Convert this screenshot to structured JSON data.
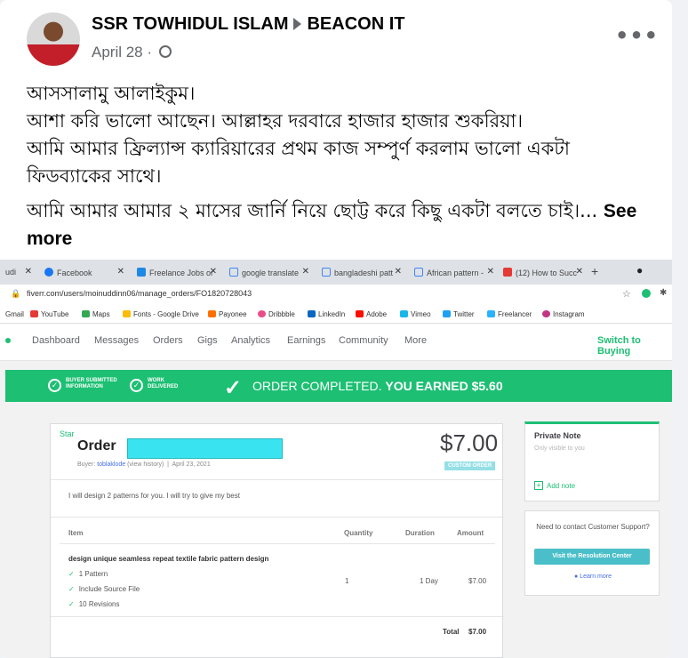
{
  "post": {
    "author": "SSR TOWHIDUL ISLAM",
    "group": "BEACON IT",
    "date": "April 28 ·",
    "more_icon": "more-options-icon",
    "line1": "আসসালামু আলাইকুম।",
    "line2": "আশা করি ভালো আছেন। আল্লাহর দরবারে হাজার হাজার শুকরিয়া।",
    "line3": "আমি আমার ফ্রিল্যান্স ক্যারিয়ারের প্রথম কাজ সম্পুর্ণ করলাম ভালো একটা ফিডব্যাকের সাথে।",
    "line4": "আমি আমার আমার ২ মাসের জার্নি নিয়ে ছোট্ট করে কিছু একটা বলতে চাই।...",
    "see_more": "See more"
  },
  "browser": {
    "tabs": [
      {
        "label": "udi",
        "color": "#1dbf73"
      },
      {
        "label": "Facebook",
        "color": "#1877f2"
      },
      {
        "label": "Freelance Jobs or",
        "color": "#1e88e5"
      },
      {
        "label": "google translate",
        "color": "#4285f4"
      },
      {
        "label": "bangladeshi patt",
        "color": "#4285f4"
      },
      {
        "label": "African pattern -",
        "color": "#4285f4"
      },
      {
        "label": "(12) How to Succ",
        "color": "#e53935"
      }
    ],
    "url": "fiverr.com/users/moinuddinn06/manage_orders/FO1820728043",
    "bookmarks": [
      {
        "label": "Gmail",
        "color": "#ea4335"
      },
      {
        "label": "YouTube",
        "color": "#e53935"
      },
      {
        "label": "Maps",
        "color": "#34a853"
      },
      {
        "label": "Fonts - Google Drive",
        "color": "#fbbc05"
      },
      {
        "label": "Payonee",
        "color": "#ff6f00"
      },
      {
        "label": "Dribbble",
        "color": "#ea4c89"
      },
      {
        "label": "LinkedIn",
        "color": "#0a66c2"
      },
      {
        "label": "Adobe",
        "color": "#fa0f00"
      },
      {
        "label": "Vimeo",
        "color": "#1ab7ea"
      },
      {
        "label": "Twitter",
        "color": "#1da1f2"
      },
      {
        "label": "Freelancer",
        "color": "#29b2fe"
      },
      {
        "label": "Instagram",
        "color": "#c13584"
      }
    ]
  },
  "fiverr": {
    "nav": [
      "Dashboard",
      "Messages",
      "Orders",
      "Gigs",
      "Analytics",
      "Earnings",
      "Community",
      "More"
    ],
    "switch": "Switch to Buying",
    "step1": [
      "BUYER SUBMITTED",
      "INFORMATION"
    ],
    "step2": [
      "WORK",
      "DELIVERED"
    ],
    "banner_text": "ORDER COMPLETED.",
    "banner_bold": "YOU EARNED $5.60",
    "star": "Star",
    "order_title": "Order",
    "buyer_label": "Buyer:",
    "buyer_name": "toblaklode",
    "view_history": "(view history)",
    "order_date": "April 23, 2021",
    "price": "$7.00",
    "custom_badge": "CUSTOM ORDER",
    "description": "I will design 2 patterns for you. I will try to give my best",
    "headers": {
      "item": "Item",
      "quantity": "Quantity",
      "duration": "Duration",
      "amount": "Amount"
    },
    "item_title": "design unique seamless repeat textile fabric pattern design",
    "features": [
      "1 Pattern",
      "Include Source File",
      "10 Revisions"
    ],
    "quantity": "1",
    "duration": "1 Day",
    "amount": "$7.00",
    "total_label": "Total",
    "total": "$7.00",
    "private_note": "Private Note",
    "note_sub": "Only visible to you",
    "add_note": "Add note",
    "support_q": "Need to contact Customer Support?",
    "support_btn": "Visit the Resolution Center",
    "learn_more": "Learn more"
  }
}
